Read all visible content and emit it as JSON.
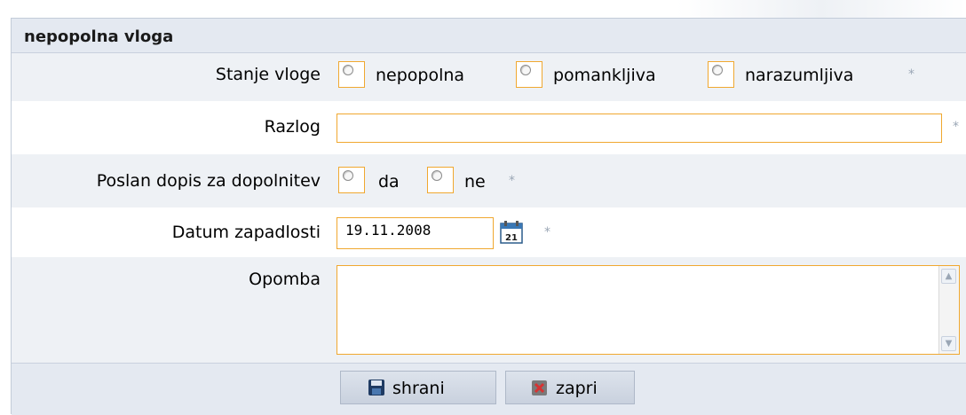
{
  "form": {
    "title": "nepopolna vloga",
    "stanje": {
      "label": "Stanje vloge",
      "options": [
        "nepopolna",
        "pomankljiva",
        "narazumljiva"
      ],
      "required": "*"
    },
    "razlog": {
      "label": "Razlog",
      "value": "",
      "required": "*"
    },
    "poslan": {
      "label": "Poslan dopis za dopolnitev",
      "options": [
        "da",
        "ne"
      ],
      "required": "*"
    },
    "datum": {
      "label": "Datum zapadlosti",
      "value": "19.11.2008",
      "calendar_day": "21",
      "required": "*"
    },
    "opomba": {
      "label": "Opomba",
      "value": ""
    },
    "buttons": {
      "save": "shrani",
      "close": "zapri"
    }
  },
  "colors": {
    "accent_border": "#f0a830",
    "header_bg": "#e4e9f1",
    "alt_row_bg": "#eef1f5"
  },
  "icons": [
    "radio-icon",
    "calendar-icon",
    "save-icon",
    "close-icon",
    "scroll-up-icon",
    "scroll-down-icon"
  ]
}
